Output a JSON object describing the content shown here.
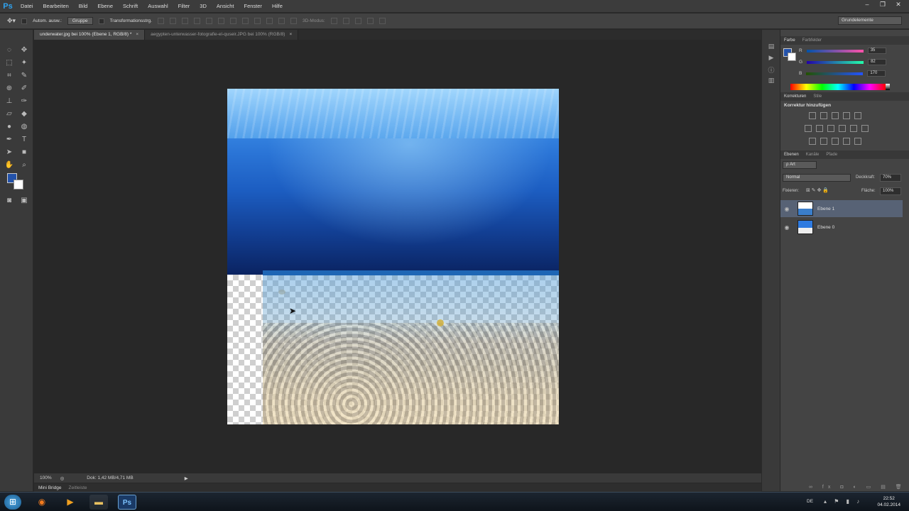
{
  "app": {
    "logo": "Ps"
  },
  "menu": [
    "Datei",
    "Bearbeiten",
    "Bild",
    "Ebene",
    "Schrift",
    "Auswahl",
    "Filter",
    "3D",
    "Ansicht",
    "Fenster",
    "Hilfe"
  ],
  "options": {
    "auto_select_label": "Autom. ausw.:",
    "auto_select_value": "Gruppe",
    "transform_label": "Transformationsstrg.",
    "mode3d_label": "3D-Modus:",
    "workspace": "Grundelemente"
  },
  "tabs": [
    {
      "label": "underwater.jpg bei 100% (Ebene 1, RGB/8) *",
      "close": "×"
    },
    {
      "label": "aegypten-unterwasser-fotografie-el-quseir.JPG bei 100% (RGB/8)",
      "close": "×"
    }
  ],
  "status": {
    "zoom": "100%",
    "doc": "Dok: 1,42 MB/4,71 MB",
    "arrow": "▶"
  },
  "bridge": {
    "tab1": "Mini Bridge",
    "tab2": "Zeitleiste"
  },
  "color_panel": {
    "tabs": [
      "Farbe",
      "Farbfelder"
    ],
    "r_label": "R",
    "g_label": "G",
    "b_label": "B",
    "r": "35",
    "g": "82",
    "b": "170",
    "foreground": "#2352aa",
    "background": "#ffffff"
  },
  "adjust_panel": {
    "tabs": [
      "Korrekturen",
      "Stile"
    ],
    "heading": "Korrektur hinzufügen"
  },
  "layers_panel": {
    "tabs": [
      "Ebenen",
      "Kanäle",
      "Pfade"
    ],
    "filter": "ρ Art",
    "blend_mode": "Normal",
    "opacity_label": "Deckkraft:",
    "opacity": "70%",
    "lock_label": "Fixieren:",
    "fill_label": "Fläche:",
    "fill": "100%",
    "layers": [
      {
        "name": "Ebene 1",
        "selected": true
      },
      {
        "name": "Ebene 0",
        "selected": false
      }
    ]
  },
  "taskbar": {
    "clock_time": "22:52",
    "clock_date": "04.02.2014",
    "lang": "DE",
    "ps_label": "Ps"
  }
}
